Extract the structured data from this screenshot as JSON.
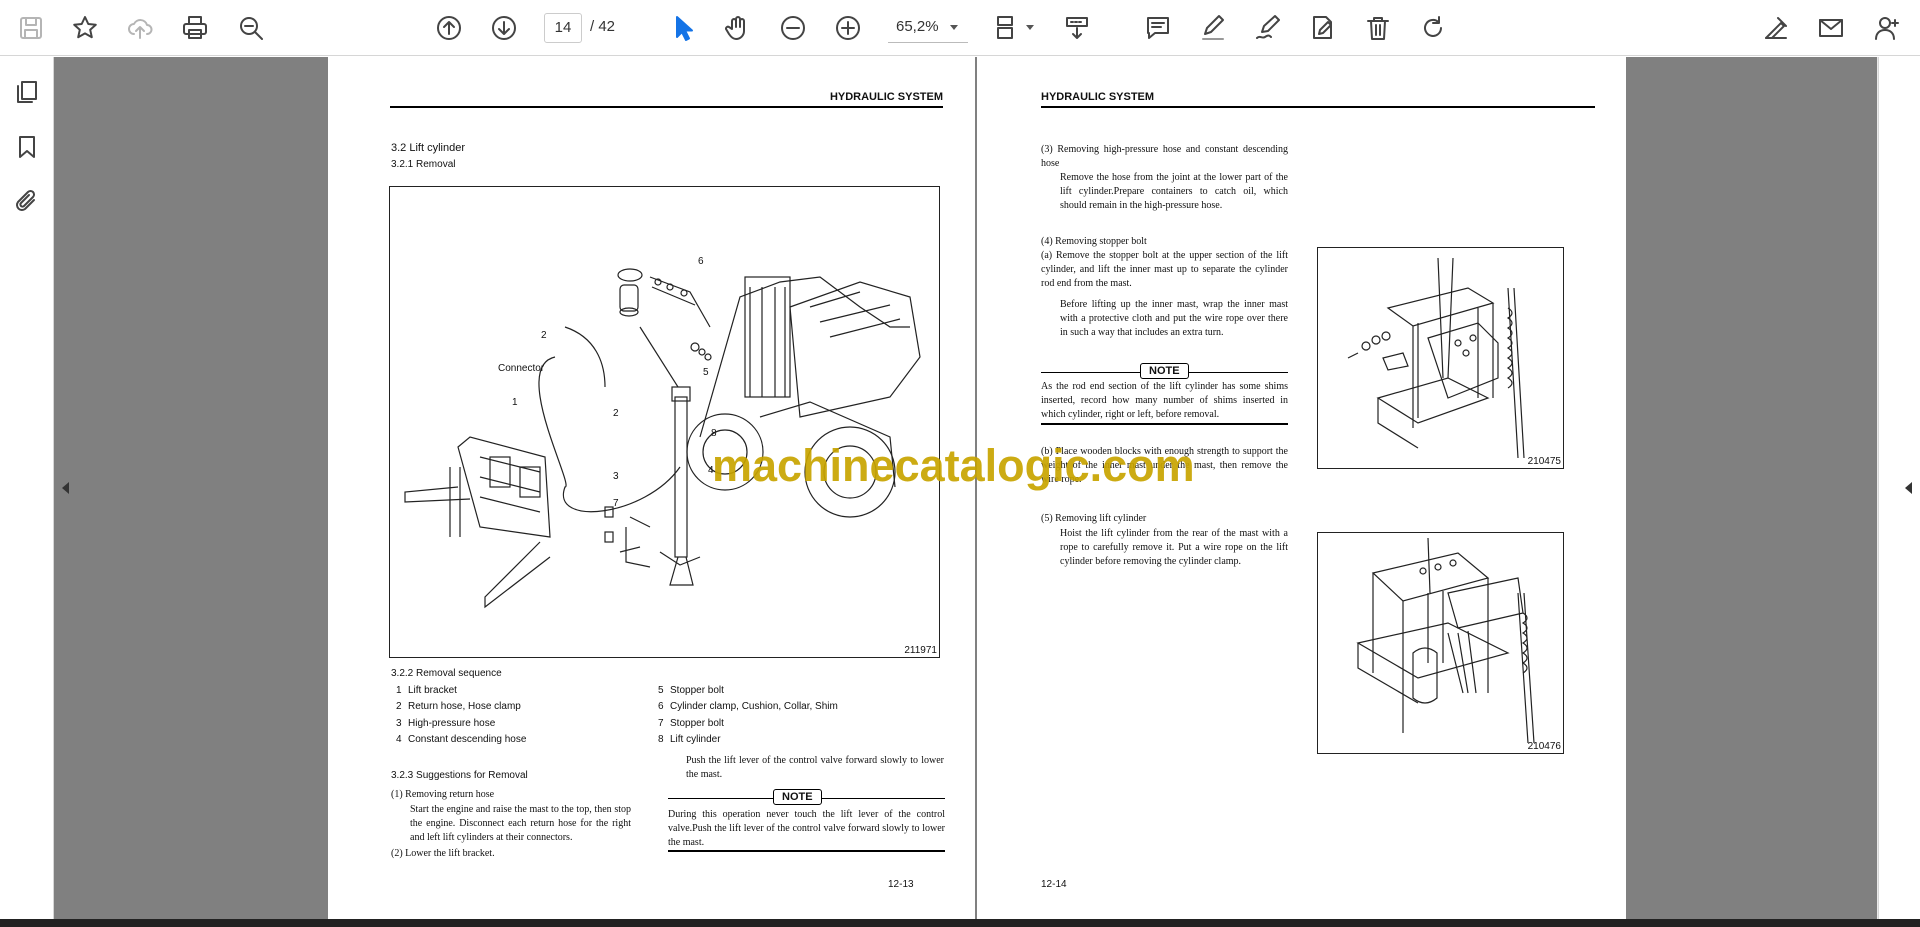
{
  "toolbar": {
    "page_current": "14",
    "page_total": "/ 42",
    "zoom": "65,2%",
    "icons": [
      "save-icon",
      "bookmark-star-icon",
      "cloud-upload-icon",
      "print-icon",
      "zoom-search-icon",
      "prev-page-icon",
      "next-page-icon",
      "select-cursor-icon",
      "hand-tool-icon",
      "zoom-out-icon",
      "zoom-in-icon",
      "page-layout-icon",
      "scroll-mode-icon",
      "comment-icon",
      "highlight-icon",
      "draw-sign-icon",
      "edit-text-icon",
      "delete-icon",
      "rotate-icon",
      "sign-share-icon",
      "mail-icon",
      "add-user-icon"
    ]
  },
  "leftrail": {
    "icons": [
      "page-thumbnails-icon",
      "bookmarks-icon",
      "attachments-icon"
    ]
  },
  "watermark": "machinecatalogic.com",
  "left_page": {
    "header": "HYDRAULIC SYSTEM",
    "section": "3.2   Lift cylinder",
    "subsection": "3.2.1   Removal",
    "figure_id": "211971",
    "figure_labels": {
      "l6": "6",
      "l2": "2",
      "connector": "Connector",
      "l5": "5",
      "l1": "1",
      "l2b": "2",
      "l8": "8",
      "l3": "3",
      "l4": "4",
      "l7": "7"
    },
    "sequence_title": "3.2.2   Removal sequence",
    "sequence": [
      {
        "n": "1",
        "t": "Lift bracket"
      },
      {
        "n": "2",
        "t": "Return hose, Hose clamp"
      },
      {
        "n": "3",
        "t": "High-pressure hose"
      },
      {
        "n": "4",
        "t": "Constant descending hose"
      },
      {
        "n": "5",
        "t": "Stopper bolt"
      },
      {
        "n": "6",
        "t": "Cylinder clamp, Cushion, Collar, Shim"
      },
      {
        "n": "7",
        "t": "Stopper bolt"
      },
      {
        "n": "8",
        "t": "Lift cylinder"
      }
    ],
    "push_text": "Push the lift lever of the control valve forward slowly to lower the mast.",
    "suggest_title": "3.2.3   Suggestions for Removal",
    "s1_head": "(1)  Removing return hose",
    "s1_body": "Start the engine and raise the mast to the top, then stop the engine. Disconnect each return hose for the right and left lift cylinders at their connectors.",
    "s2": "(2)  Lower the lift bracket.",
    "note_label": "NOTE",
    "note_text": "During this operation never touch the lift lever of the control valve.Push the lift lever of the control valve forward slowly to lower the mast.",
    "page_no": "12-13"
  },
  "right_page": {
    "header": "HYDRAULIC SYSTEM",
    "s3_head": "(3)  Removing high-pressure hose and constant descending hose",
    "s3_body": "Remove the hose from the joint at the lower part of the lift cylinder.Prepare containers to catch oil, which should remain in the high-pressure hose.",
    "s4_head": "(4)  Removing stopper bolt",
    "s4a": "(a)  Remove the stopper bolt at the upper section of the lift cylinder, and lift the inner mast up to separate the cylinder rod end from the mast.",
    "s4a2": "Before lifting up the inner mast, wrap the inner mast with a protective cloth and put the wire rope over there in such a way that includes an extra turn.",
    "note_label": "NOTE",
    "note_text": "As the rod end section of the lift cylinder has some shims inserted, record how many number of shims inserted in which cylinder, right or left, before removal.",
    "s4b": "(b)  Place wooden blocks with enough strength to support the weight of the inner mast under the mast, then remove the wire rope.",
    "s5_head": "(5)  Removing lift cylinder",
    "s5_body": "Hoist the lift cylinder from the rear of the mast with a rope to carefully remove it. Put a wire rope on the lift cylinder before removing the cylinder clamp.",
    "fig1_id": "210475",
    "fig2_id": "210476",
    "page_no": "12-14"
  }
}
